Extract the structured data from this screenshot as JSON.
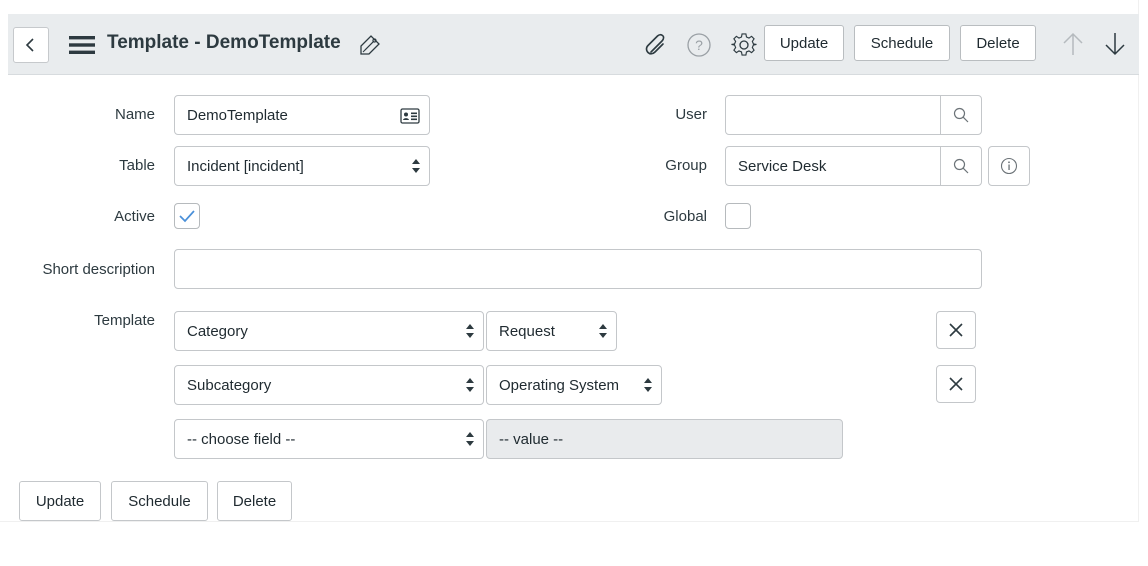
{
  "header": {
    "title": "Template - DemoTemplate",
    "buttons": {
      "update": "Update",
      "schedule": "Schedule",
      "delete": "Delete"
    },
    "help_glyph": "?"
  },
  "form": {
    "name": {
      "label": "Name",
      "value": "DemoTemplate"
    },
    "table": {
      "label": "Table",
      "value": "Incident [incident]"
    },
    "active": {
      "label": "Active",
      "checked": true
    },
    "user": {
      "label": "User",
      "value": ""
    },
    "group": {
      "label": "Group",
      "value": "Service Desk"
    },
    "global": {
      "label": "Global",
      "checked": false
    },
    "short_description": {
      "label": "Short description",
      "value": ""
    },
    "template": {
      "label": "Template",
      "rows": [
        {
          "field": "Category",
          "value": "Request"
        },
        {
          "field": "Subcategory",
          "value": "Operating System"
        }
      ],
      "new_row": {
        "field": "-- choose field --",
        "value": "-- value --"
      }
    }
  },
  "footer": {
    "update": "Update",
    "schedule": "Schedule",
    "delete": "Delete"
  },
  "colors": {
    "header_bg": "#e9ecee",
    "check": "#4a90d9",
    "border": "#c4c7ca",
    "disabled_bg": "#e9ebed"
  }
}
